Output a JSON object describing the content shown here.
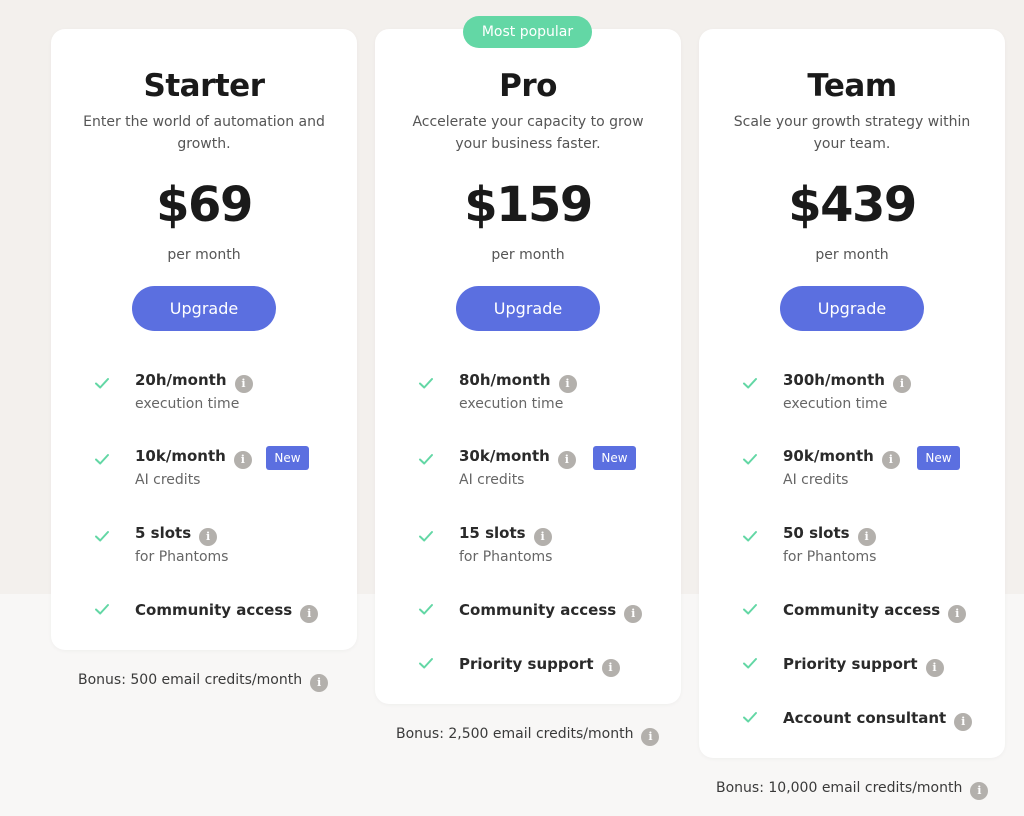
{
  "colors": {
    "accent": "#5b6fe0",
    "check": "#63d7a5",
    "popular": "#63d7a5",
    "info_icon": "#b3b0ac",
    "page_bg": "#f3f0ed"
  },
  "plans": [
    {
      "name": "Starter",
      "description": "Enter the world of automation and growth.",
      "price": "$69",
      "period": "per month",
      "button": "Upgrade",
      "features": [
        {
          "title": "20h/month",
          "subtitle": "execution time",
          "icon": "check-icon",
          "info_icon": "info-icon"
        },
        {
          "title": "10k/month",
          "subtitle": "AI credits",
          "badge": "New",
          "icon": "check-icon",
          "info_icon": "info-icon"
        },
        {
          "title": "5 slots",
          "subtitle": "for Phantoms",
          "icon": "check-icon",
          "info_icon": "info-icon"
        },
        {
          "title": "Community access",
          "icon": "check-icon",
          "info_icon": "info-icon"
        }
      ],
      "bonus": "Bonus: 500 email credits/month"
    },
    {
      "name": "Pro",
      "badge": "Most popular",
      "description": "Accelerate your capacity to grow your business faster.",
      "price": "$159",
      "period": "per month",
      "button": "Upgrade",
      "features": [
        {
          "title": "80h/month",
          "subtitle": "execution time",
          "icon": "check-icon",
          "info_icon": "info-icon"
        },
        {
          "title": "30k/month",
          "subtitle": "AI credits",
          "badge": "New",
          "icon": "check-icon",
          "info_icon": "info-icon"
        },
        {
          "title": "15 slots",
          "subtitle": "for Phantoms",
          "icon": "check-icon",
          "info_icon": "info-icon"
        },
        {
          "title": "Community access",
          "icon": "check-icon",
          "info_icon": "info-icon"
        },
        {
          "title": "Priority support",
          "icon": "check-icon",
          "info_icon": "info-icon"
        }
      ],
      "bonus": "Bonus: 2,500 email credits/month"
    },
    {
      "name": "Team",
      "description": "Scale your growth strategy within your team.",
      "price": "$439",
      "period": "per month",
      "button": "Upgrade",
      "features": [
        {
          "title": "300h/month",
          "subtitle": "execution time",
          "icon": "check-icon",
          "info_icon": "info-icon"
        },
        {
          "title": "90k/month",
          "subtitle": "AI credits",
          "badge": "New",
          "icon": "check-icon",
          "info_icon": "info-icon"
        },
        {
          "title": "50 slots",
          "subtitle": "for Phantoms",
          "icon": "check-icon",
          "info_icon": "info-icon"
        },
        {
          "title": "Community access",
          "icon": "check-icon",
          "info_icon": "info-icon"
        },
        {
          "title": "Priority support",
          "icon": "check-icon",
          "info_icon": "info-icon"
        },
        {
          "title": "Account consultant",
          "icon": "check-icon",
          "info_icon": "info-icon"
        }
      ],
      "bonus": "Bonus: 10,000 email credits/month"
    }
  ]
}
